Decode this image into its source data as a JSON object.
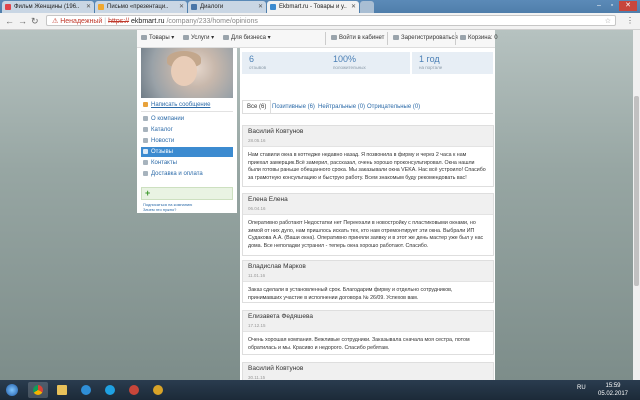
{
  "browser": {
    "tabs": [
      {
        "label": "Фильм Женщины (196..",
        "favicon_color": "#e0444b"
      },
      {
        "label": "Письмо «презентаци..",
        "favicon_color": "#f0a830"
      },
      {
        "label": "Диалоги",
        "favicon_color": "#4a76a8"
      },
      {
        "label": "Ekbmart.ru - Товары и у..",
        "favicon_color": "#3c8bd0"
      }
    ],
    "address": {
      "security": "Ненадежный",
      "scheme": "https://",
      "host": "ekbmart.ru",
      "path": "/company/233/home/opinions"
    }
  },
  "topnav": {
    "products": "Товары",
    "services": "Услуги",
    "business": "Для бизнеса",
    "login": "Войти в кабинет",
    "register": "Зарегистрироваться",
    "cart": "Корзина: 0"
  },
  "sidebar": {
    "write_message": "Написать сообщение",
    "items": [
      {
        "label": "О компании"
      },
      {
        "label": "Каталог"
      },
      {
        "label": "Новости"
      },
      {
        "label": "Отзывы"
      },
      {
        "label": "Контакты"
      },
      {
        "label": "Доставка и оплата"
      }
    ],
    "subscribe_link": "Подписаться на компанию",
    "why_link": "Зачем это нужно?"
  },
  "stats": [
    {
      "value": "6",
      "label": "отзывов"
    },
    {
      "value": "100%",
      "label": "положительных"
    },
    {
      "value": "1 год",
      "label": "на портале"
    }
  ],
  "filters": [
    {
      "label": "Все (6)"
    },
    {
      "label": "Позитивные (6)"
    },
    {
      "label": "Нейтральные (0)"
    },
    {
      "label": "Отрицательные (0)"
    }
  ],
  "reviews": [
    {
      "name": "Василий Ковтунов",
      "date": "28.05.16",
      "text": "Нам ставили окна в коттедже недавно назад. Я позвонила в фирму и через 2 часа к нам приехал замерщик.Всё замерил, рассказал, очень хорошо проконсультировал. Окна нашли были готовы раньше обещанного срока. Мы заказывали окна VEKA. Нас всё устроило! Спасибо за грамотную консультацию и быструю работу. Всем знакомым буду рекомендовать вас!"
    },
    {
      "name": "Елена Елена",
      "date": "06.04.16",
      "text": "Оперативно работают Недостатки нет Переехали в новостройку с пластиковыми окнами, но зимой от них дуло, нам пришлось искать тех, кто нам отремонтирует эти окна. Выбрали ИП Судакова А.А. (Ваши окна). Оперативно приняли заявку и в этот же день мастер уже был у нас дома. Все неполадки устранил - теперь окна хорошо работают. Спасибо."
    },
    {
      "name": "Владислав Марков",
      "date": "11.01.16",
      "text": "Заказ сделали в установленный срок. Благодарим фирму и отдельно сотрудников, принимавших участие в исполнении договора № 26/09. Успехов вам."
    },
    {
      "name": "Елизавета Федяшева",
      "date": "17.12.15",
      "text": "Очень хорошая компания. Вежливые сотрудники. Заказывала сначала моя сестра, потом обратилась и мы. Красиво и недорого. Спасибо ребятам."
    },
    {
      "name": "Василий Ковтунов",
      "date": "30.11.15",
      "text": ""
    }
  ],
  "taskbar": {
    "language": "RU",
    "time": "15:59",
    "date": "05.02.2017"
  }
}
